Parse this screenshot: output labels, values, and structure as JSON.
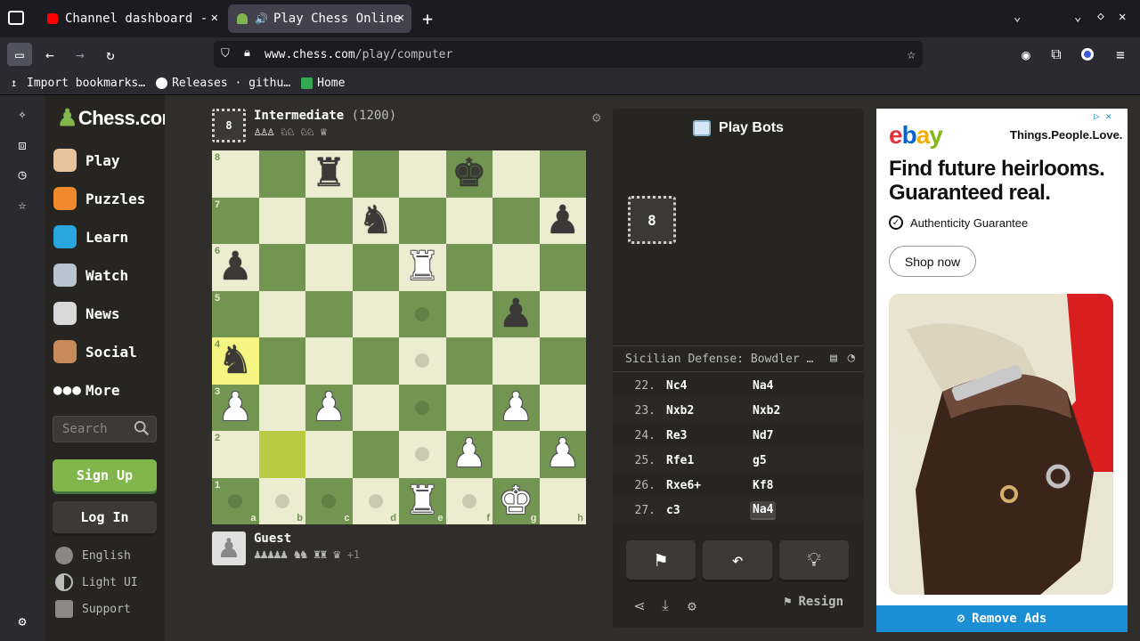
{
  "browser": {
    "tabs": [
      {
        "title": "Channel dashboard -",
        "active": false
      },
      {
        "title": "Play Chess Online",
        "active": true
      }
    ],
    "url_domain": "www.chess.com",
    "url_path": "/play/computer",
    "bookmarks": [
      "Import bookmarks…",
      "Releases · githu…",
      "Home"
    ]
  },
  "sidebar": {
    "logo": "Chess.com",
    "nav": [
      {
        "label": "Play",
        "icon": "play-icon"
      },
      {
        "label": "Puzzles",
        "icon": "puzzle-icon"
      },
      {
        "label": "Learn",
        "icon": "learn-icon"
      },
      {
        "label": "Watch",
        "icon": "binoculars-icon"
      },
      {
        "label": "News",
        "icon": "news-icon"
      },
      {
        "label": "Social",
        "icon": "social-icon"
      },
      {
        "label": "More",
        "icon": "more-icon"
      }
    ],
    "search_placeholder": "Search",
    "signup": "Sign Up",
    "login": "Log In",
    "footer": [
      "English",
      "Light UI",
      "Support"
    ]
  },
  "game": {
    "opponent": {
      "name": "Intermediate",
      "rating": "(1200)",
      "captured": "♙♙♙ ♘♘ ♘♘ ♕",
      "badge": "8"
    },
    "player": {
      "name": "Guest",
      "captured": "♟♟♟♟♟ ♞♞ ♜♜ ♛",
      "advantage": "+1"
    },
    "board": {
      "files": [
        "a",
        "b",
        "c",
        "d",
        "e",
        "f",
        "g",
        "h"
      ],
      "ranks": [
        "8",
        "7",
        "6",
        "5",
        "4",
        "3",
        "2",
        "1"
      ],
      "pieces": [
        {
          "sq": "c8",
          "glyph": "♜",
          "color": "b"
        },
        {
          "sq": "f8",
          "glyph": "♚",
          "color": "b"
        },
        {
          "sq": "d7",
          "glyph": "♞",
          "color": "b"
        },
        {
          "sq": "h7",
          "glyph": "♟",
          "color": "b"
        },
        {
          "sq": "a6",
          "glyph": "♟",
          "color": "b"
        },
        {
          "sq": "e6",
          "glyph": "♜",
          "color": "w"
        },
        {
          "sq": "g5",
          "glyph": "♟",
          "color": "b"
        },
        {
          "sq": "a4",
          "glyph": "♞",
          "color": "b"
        },
        {
          "sq": "a3",
          "glyph": "♟",
          "color": "w"
        },
        {
          "sq": "c3",
          "glyph": "♟",
          "color": "w"
        },
        {
          "sq": "g3",
          "glyph": "♟",
          "color": "w"
        },
        {
          "sq": "f2",
          "glyph": "♟",
          "color": "w"
        },
        {
          "sq": "h2",
          "glyph": "♟",
          "color": "w"
        },
        {
          "sq": "e1",
          "glyph": "♜",
          "color": "w"
        },
        {
          "sq": "g1",
          "glyph": "♚",
          "color": "w"
        }
      ],
      "highlights": [
        "a4",
        "b2"
      ],
      "hints": [
        "e5",
        "e4",
        "e3",
        "e2",
        "a1",
        "b1",
        "c1",
        "d1",
        "f1"
      ]
    }
  },
  "panel": {
    "title": "Play Bots",
    "bot_level": "8",
    "opening": "Sicilian Defense: Bowdler …",
    "moves": [
      {
        "n": "22.",
        "w": "Nc4",
        "b": "Na4"
      },
      {
        "n": "23.",
        "w": "Nxb2",
        "b": "Nxb2"
      },
      {
        "n": "24.",
        "w": "Re3",
        "b": "Nd7"
      },
      {
        "n": "25.",
        "w": "Rfe1",
        "b": "g5"
      },
      {
        "n": "26.",
        "w": "Rxe6+",
        "b": "Kf8"
      },
      {
        "n": "27.",
        "w": "c3",
        "b": "Na4"
      }
    ],
    "resign": "Resign"
  },
  "ad": {
    "brand": "ebay",
    "tagline": "Things.People.Love.",
    "headline": "Find future heirlooms. Guaranteed real.",
    "auth": "Authenticity Guarantee",
    "cta": "Shop now",
    "remove": "Remove Ads"
  }
}
